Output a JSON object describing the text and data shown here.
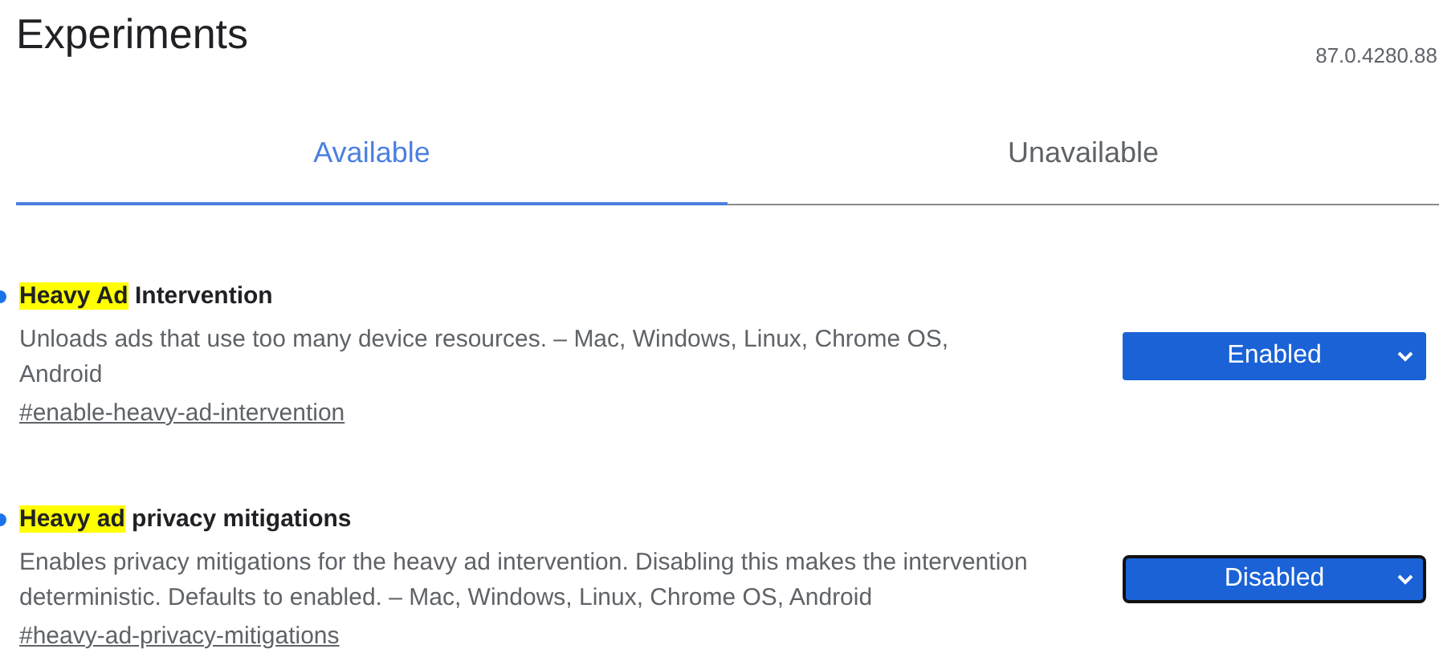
{
  "header": {
    "title": "Experiments",
    "version": "87.0.4280.88"
  },
  "tabs": [
    {
      "label": "Available",
      "selected": true
    },
    {
      "label": "Unavailable",
      "selected": false
    }
  ],
  "experiments": [
    {
      "modified": true,
      "title_match": "Heavy Ad",
      "title_rest": "Intervention",
      "description": "Unloads ads that use too many device resources. – Mac, Windows, Linux, Chrome OS, Android",
      "link": "#enable-heavy-ad-intervention",
      "value": "Enabled",
      "focused": false
    },
    {
      "modified": true,
      "title_match": "Heavy ad",
      "title_rest": "privacy mitigations",
      "description": "Enables privacy mitigations for the heavy ad intervention. Disabling this makes the intervention deterministic. Defaults to enabled. – Mac, Windows, Linux, Chrome OS, Android",
      "link": "#heavy-ad-privacy-mitigations",
      "value": "Disabled",
      "focused": true
    }
  ]
}
